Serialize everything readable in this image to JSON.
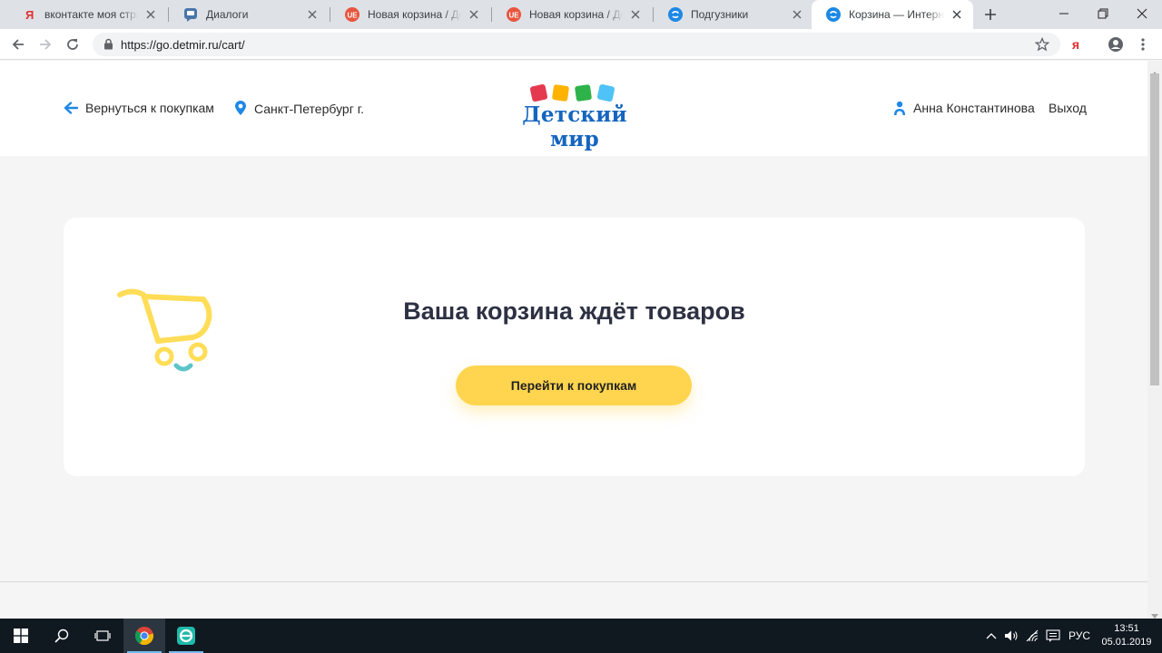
{
  "browser": {
    "tabs": [
      {
        "title": "вконтакте моя страница",
        "icon": "yandex-icon",
        "active": false
      },
      {
        "title": "Диалоги",
        "icon": "vk-messages-icon",
        "active": false
      },
      {
        "title": "Новая корзина / Детский мир",
        "icon": "ue-icon",
        "active": false
      },
      {
        "title": "Новая корзина / Детский мир",
        "icon": "ue-icon",
        "active": false
      },
      {
        "title": "Подгузники",
        "icon": "detmir-icon",
        "active": false
      },
      {
        "title": "Корзина — Интернет-магазин",
        "icon": "detmir-icon",
        "active": true
      }
    ],
    "url": "https://go.detmir.ru/cart/",
    "extension_label": "я"
  },
  "header": {
    "back_label": "Вернуться к покупкам",
    "city": "Санкт-Петербург г.",
    "logo_text": "Детский мир",
    "user_name": "Анна Константинова",
    "logout_label": "Выход"
  },
  "cart": {
    "empty_title": "Ваша корзина ждёт товаров",
    "button_label": "Перейти к покупкам"
  },
  "taskbar": {
    "language": "РУС",
    "time": "13:51",
    "date": "05.01.2019"
  },
  "colors": {
    "accent_blue": "#1565c0",
    "button_yellow": "#ffd54f",
    "logo_squares": [
      "#e53950",
      "#ffb300",
      "#2eb34a",
      "#4fc3f7"
    ]
  }
}
